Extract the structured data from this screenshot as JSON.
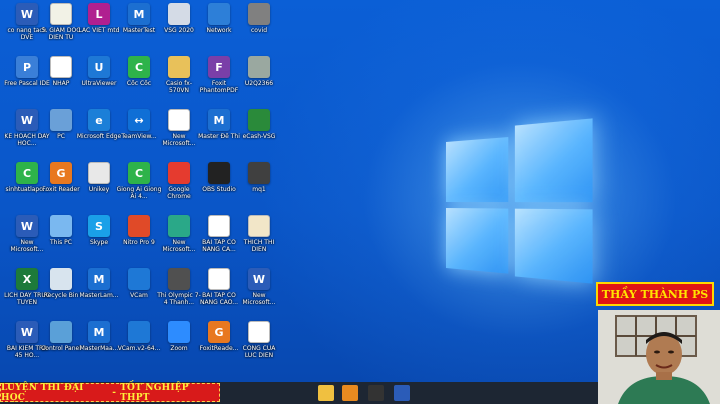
{
  "desktop_icons": [
    {
      "label": "co nang tach DVE",
      "icon": "word-doc-icon",
      "color": "#2b5cb8",
      "glyph": "W"
    },
    {
      "label": "5. GIAM DOC DIEN TU",
      "icon": "document-icon",
      "color": "#f2f2e6",
      "glyph": ""
    },
    {
      "label": "LAC VIET mtd",
      "icon": "lacviet-icon",
      "color": "#b02090",
      "glyph": "L"
    },
    {
      "label": "MasterTest",
      "icon": "mastertest-icon",
      "color": "#1c6fd1",
      "glyph": "M"
    },
    {
      "label": "VSG 2020",
      "icon": "vsg-icon",
      "color": "#d4dbe6",
      "glyph": ""
    },
    {
      "label": "Network",
      "icon": "network-icon",
      "color": "#2d7fd8",
      "glyph": ""
    },
    {
      "label": "covid",
      "icon": "folder-image-icon",
      "color": "#808080",
      "glyph": ""
    },
    {
      "label": "Free Pascal IDE",
      "icon": "pascal-icon",
      "color": "#3a7fd8",
      "glyph": "P"
    },
    {
      "label": "NHAP",
      "icon": "document-icon",
      "color": "#ffffff",
      "glyph": ""
    },
    {
      "label": "UltraViewer",
      "icon": "ultraviewer-icon",
      "color": "#1e78d6",
      "glyph": "U"
    },
    {
      "label": "Cốc Cốc",
      "icon": "coccoc-icon",
      "color": "#2eb34a",
      "glyph": "C"
    },
    {
      "label": "Casio fx-570VN",
      "icon": "folder-icon",
      "color": "#e8c15a",
      "glyph": ""
    },
    {
      "label": "Foxit PhantomPDF",
      "icon": "pdf-icon",
      "color": "#7a3fa8",
      "glyph": "F"
    },
    {
      "label": "U2Q2366",
      "icon": "image-icon",
      "color": "#9aa8a0",
      "glyph": ""
    },
    {
      "label": "KE HOACH DAY HOC...",
      "icon": "word-doc-icon",
      "color": "#2b5cb8",
      "glyph": "W"
    },
    {
      "label": "PC",
      "icon": "user-icon",
      "color": "#6aa0d8",
      "glyph": ""
    },
    {
      "label": "Microsoft Edge",
      "icon": "edge-icon",
      "color": "#1b7fd8",
      "glyph": "e"
    },
    {
      "label": "TeamView...",
      "icon": "teamviewer-icon",
      "color": "#0f6fd6",
      "glyph": "↔"
    },
    {
      "label": "New Microsoft...",
      "icon": "document-icon",
      "color": "#ffffff",
      "glyph": ""
    },
    {
      "label": "Master Đề Thi",
      "icon": "master-icon",
      "color": "#1c6fd1",
      "glyph": "M"
    },
    {
      "label": "eCash-VSG",
      "icon": "ecash-icon",
      "color": "#2a8a3a",
      "glyph": ""
    },
    {
      "label": "sinhtuatlapo...",
      "icon": "coccoc-icon",
      "color": "#2eb34a",
      "glyph": "C"
    },
    {
      "label": "Foxit Reader",
      "icon": "foxit-reader-icon",
      "color": "#e87820",
      "glyph": "G"
    },
    {
      "label": "Unikey",
      "icon": "keyboard-icon",
      "color": "#e8e8e8",
      "glyph": ""
    },
    {
      "label": "Giong Ai Giong Ai 4...",
      "icon": "coccoc-icon",
      "color": "#2eb34a",
      "glyph": "C"
    },
    {
      "label": "Google Chrome",
      "icon": "chrome-icon",
      "color": "#e53b2f",
      "glyph": ""
    },
    {
      "label": "OBS Studio",
      "icon": "obs-icon",
      "color": "#222222",
      "glyph": ""
    },
    {
      "label": "mq1",
      "icon": "image-icon",
      "color": "#404040",
      "glyph": ""
    },
    {
      "label": "New Microsoft...",
      "icon": "word-doc-icon",
      "color": "#2b5cb8",
      "glyph": "W"
    },
    {
      "label": "This PC",
      "icon": "this-pc-icon",
      "color": "#7ab8f0",
      "glyph": ""
    },
    {
      "label": "Skype",
      "icon": "skype-icon",
      "color": "#1aa0e8",
      "glyph": "S"
    },
    {
      "label": "Nitro Pro 9",
      "icon": "nitro-icon",
      "color": "#e04a28",
      "glyph": ""
    },
    {
      "label": "New Microsoft...",
      "icon": "image-icon",
      "color": "#2aa888",
      "glyph": ""
    },
    {
      "label": "BAI TAP CO NANG CA...",
      "icon": "document-icon",
      "color": "#ffffff",
      "glyph": ""
    },
    {
      "label": "THICH THI DIEN",
      "icon": "document-icon",
      "color": "#f2e6c8",
      "glyph": ""
    },
    {
      "label": "LICH DAY TRUC TUYEN",
      "icon": "excel-doc-icon",
      "color": "#1d7a3a",
      "glyph": "X"
    },
    {
      "label": "Recycle Bin",
      "icon": "recycle-bin-icon",
      "color": "#d8e4ee",
      "glyph": ""
    },
    {
      "label": "MasterLam...",
      "icon": "master-icon",
      "color": "#1c6fd1",
      "glyph": "M"
    },
    {
      "label": "VCam",
      "icon": "vcam-icon",
      "color": "#1e78d6",
      "glyph": ""
    },
    {
      "label": "Thi Olympic 7-4 Thanh...",
      "icon": "image-icon",
      "color": "#505050",
      "glyph": ""
    },
    {
      "label": "BAI TAP CO NANG CAO...",
      "icon": "document-icon",
      "color": "#ffffff",
      "glyph": ""
    },
    {
      "label": "New Microsoft...",
      "icon": "word-doc-icon",
      "color": "#2b5cb8",
      "glyph": "W"
    },
    {
      "label": "BAI KIEM TRA 45 HO...",
      "icon": "word-doc-icon",
      "color": "#2b5cb8",
      "glyph": "W"
    },
    {
      "label": "Control Panel",
      "icon": "control-panel-icon",
      "color": "#5aa0d8",
      "glyph": ""
    },
    {
      "label": "MasterMaa...",
      "icon": "master-icon",
      "color": "#1c6fd1",
      "glyph": "M"
    },
    {
      "label": "VCam.v2-64...",
      "icon": "vcam-icon",
      "color": "#1e78d6",
      "glyph": ""
    },
    {
      "label": "Zoom",
      "icon": "zoom-icon",
      "color": "#2d8cff",
      "glyph": ""
    },
    {
      "label": "FoxitReade...",
      "icon": "foxit-reader-icon",
      "color": "#e87820",
      "glyph": "G"
    },
    {
      "label": "CONG CUA LUC DIEN",
      "icon": "document-icon",
      "color": "#ffffff",
      "glyph": ""
    }
  ],
  "banner": {
    "left_text": "LUYỆN THI ĐẠI HỌC",
    "separator": "-",
    "right_text": "TỐT NGHIỆP THPT"
  },
  "name_box": {
    "text": "THẦY THÀNH PS"
  },
  "taskbar": {
    "items": [
      {
        "icon": "file-explorer-icon",
        "color": "#f0c040"
      },
      {
        "icon": "store-icon",
        "color": "#e88a20"
      },
      {
        "icon": "obs-icon",
        "color": "#333333"
      },
      {
        "icon": "word-icon",
        "color": "#2b5cb8"
      }
    ]
  },
  "colors": {
    "banner_bg": "#d81a1a",
    "banner_text": "#ffef3a",
    "name_bg": "#e01414",
    "name_text": "#ffe500",
    "desktop": "#0a5ed8"
  }
}
